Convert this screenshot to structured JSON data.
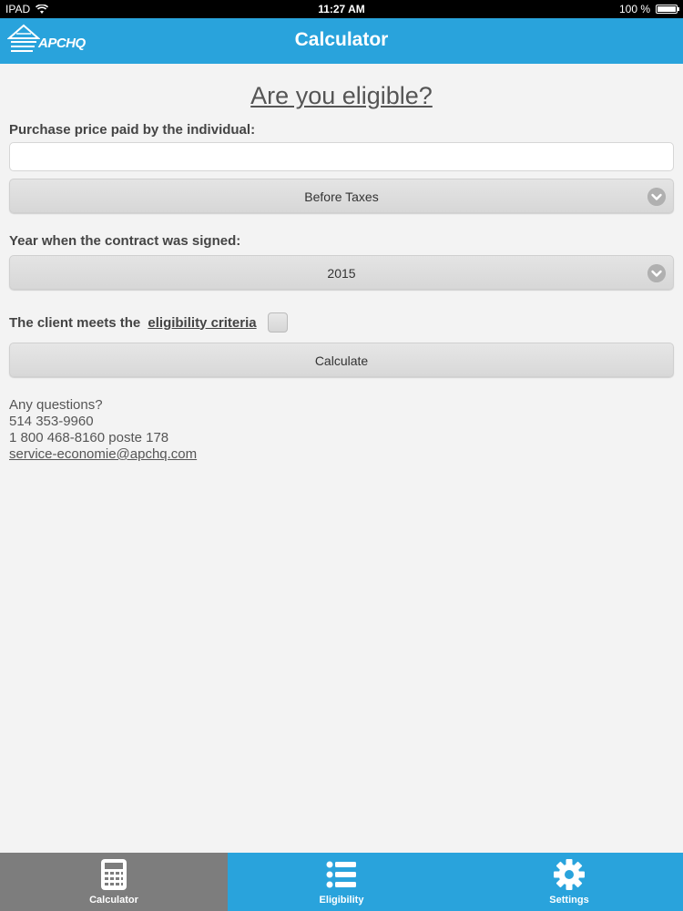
{
  "status_bar": {
    "carrier": "IPAD",
    "time": "11:27 AM",
    "battery": "100 %"
  },
  "header": {
    "logo_text": "APCHQ",
    "title": "Calculator"
  },
  "main": {
    "heading": "Are you eligible?",
    "purchase_label": "Purchase price paid by the individual:",
    "purchase_value": "",
    "tax_select": "Before Taxes",
    "year_label": "Year when the contract was signed:",
    "year_select": "2015",
    "criteria_prefix": "The client meets the",
    "criteria_link": "eligibility criteria",
    "calculate_label": "Calculate"
  },
  "contact": {
    "question": "Any questions?",
    "phone1": "514 353-9960",
    "phone2": "1 800 468-8160 poste 178",
    "email": "service-economie@apchq.com"
  },
  "tabs": [
    {
      "label": "Calculator",
      "icon": "calculator-icon",
      "active": true
    },
    {
      "label": "Eligibility",
      "icon": "list-icon",
      "active": false
    },
    {
      "label": "Settings",
      "icon": "gear-icon",
      "active": false
    }
  ],
  "colors": {
    "brand_blue": "#29a3dc",
    "active_tab": "#7d7d7d"
  }
}
